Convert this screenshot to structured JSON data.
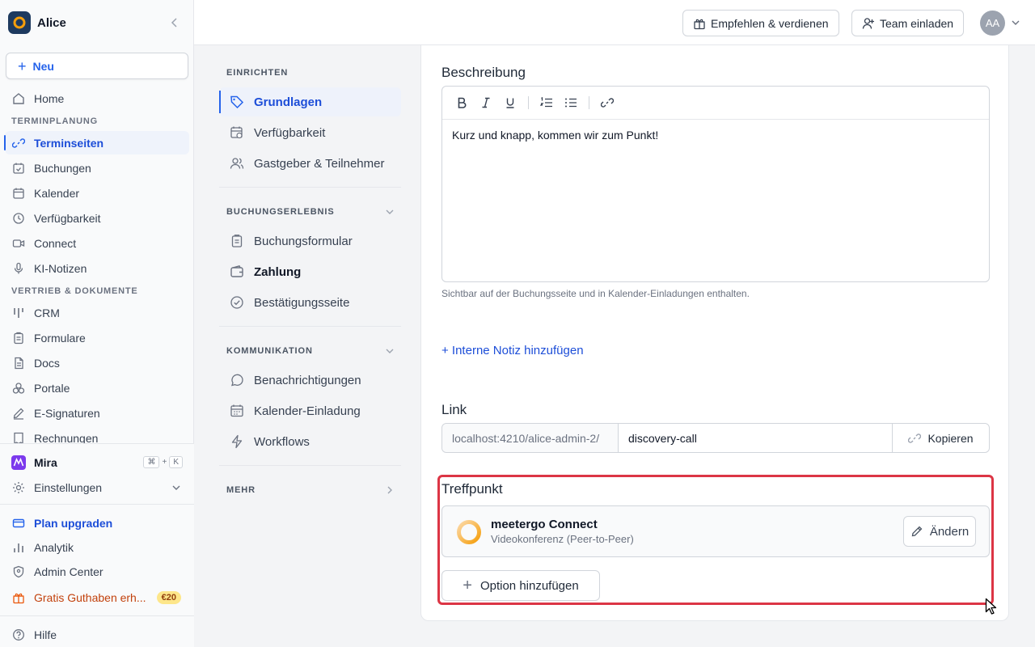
{
  "sidebar": {
    "workspace": "Alice",
    "new_label": "Neu",
    "home": "Home",
    "section_scheduling": "TERMINPLANUNG",
    "scheduling_items": [
      "Terminseiten",
      "Buchungen",
      "Kalender",
      "Verfügbarkeit",
      "Connect",
      "KI-Notizen"
    ],
    "section_sales": "VERTRIEB & DOKUMENTE",
    "sales_items": [
      "CRM",
      "Formulare",
      "Docs",
      "Portale",
      "E-Signaturen",
      "Rechnungen"
    ],
    "mira": "Mira",
    "mira_shortcut": [
      "⌘",
      "+",
      "K"
    ],
    "settings": "Einstellungen",
    "upgrade": "Plan upgraden",
    "analytics": "Analytik",
    "admin": "Admin Center",
    "credit": "Gratis Guthaben erh...",
    "credit_badge": "€20",
    "help": "Hilfe"
  },
  "topbar": {
    "refer_label": "Empfehlen & verdienen",
    "invite_label": "Team einladen",
    "avatar_initials": "AA"
  },
  "subnav": {
    "section_setup": "EINRICHTEN",
    "setup_items": [
      "Grundlagen",
      "Verfügbarkeit",
      "Gastgeber & Teilnehmer"
    ],
    "section_booking": "BUCHUNGSERLEBNIS",
    "booking_items": [
      "Buchungsformular",
      "Zahlung",
      "Bestätigungsseite"
    ],
    "section_comm": "KOMMUNIKATION",
    "comm_items": [
      "Benachrichtigungen",
      "Kalender-Einladung",
      "Workflows"
    ],
    "section_more": "MEHR"
  },
  "main": {
    "description_label": "Beschreibung",
    "description_text": "Kurz und knapp, kommen wir zum Punkt!",
    "description_hint": "Sichtbar auf der Buchungsseite und in Kalender-Einladungen enthalten.",
    "add_note": "+ Interne Notiz hinzufügen",
    "link_label": "Link",
    "link_prefix": "localhost:4210/alice-admin-2/",
    "link_slug": "discovery-call",
    "copy_label": "Kopieren",
    "meeting_label": "Treffpunkt",
    "location_name": "meetergo Connect",
    "location_sub": "Videokonferenz (Peer-to-Peer)",
    "change_label": "Ändern",
    "add_option_label": "Option hinzufügen"
  },
  "colors": {
    "accent": "#2563eb",
    "highlight": "#dc3545",
    "logo_orange": "#f59e0b"
  }
}
